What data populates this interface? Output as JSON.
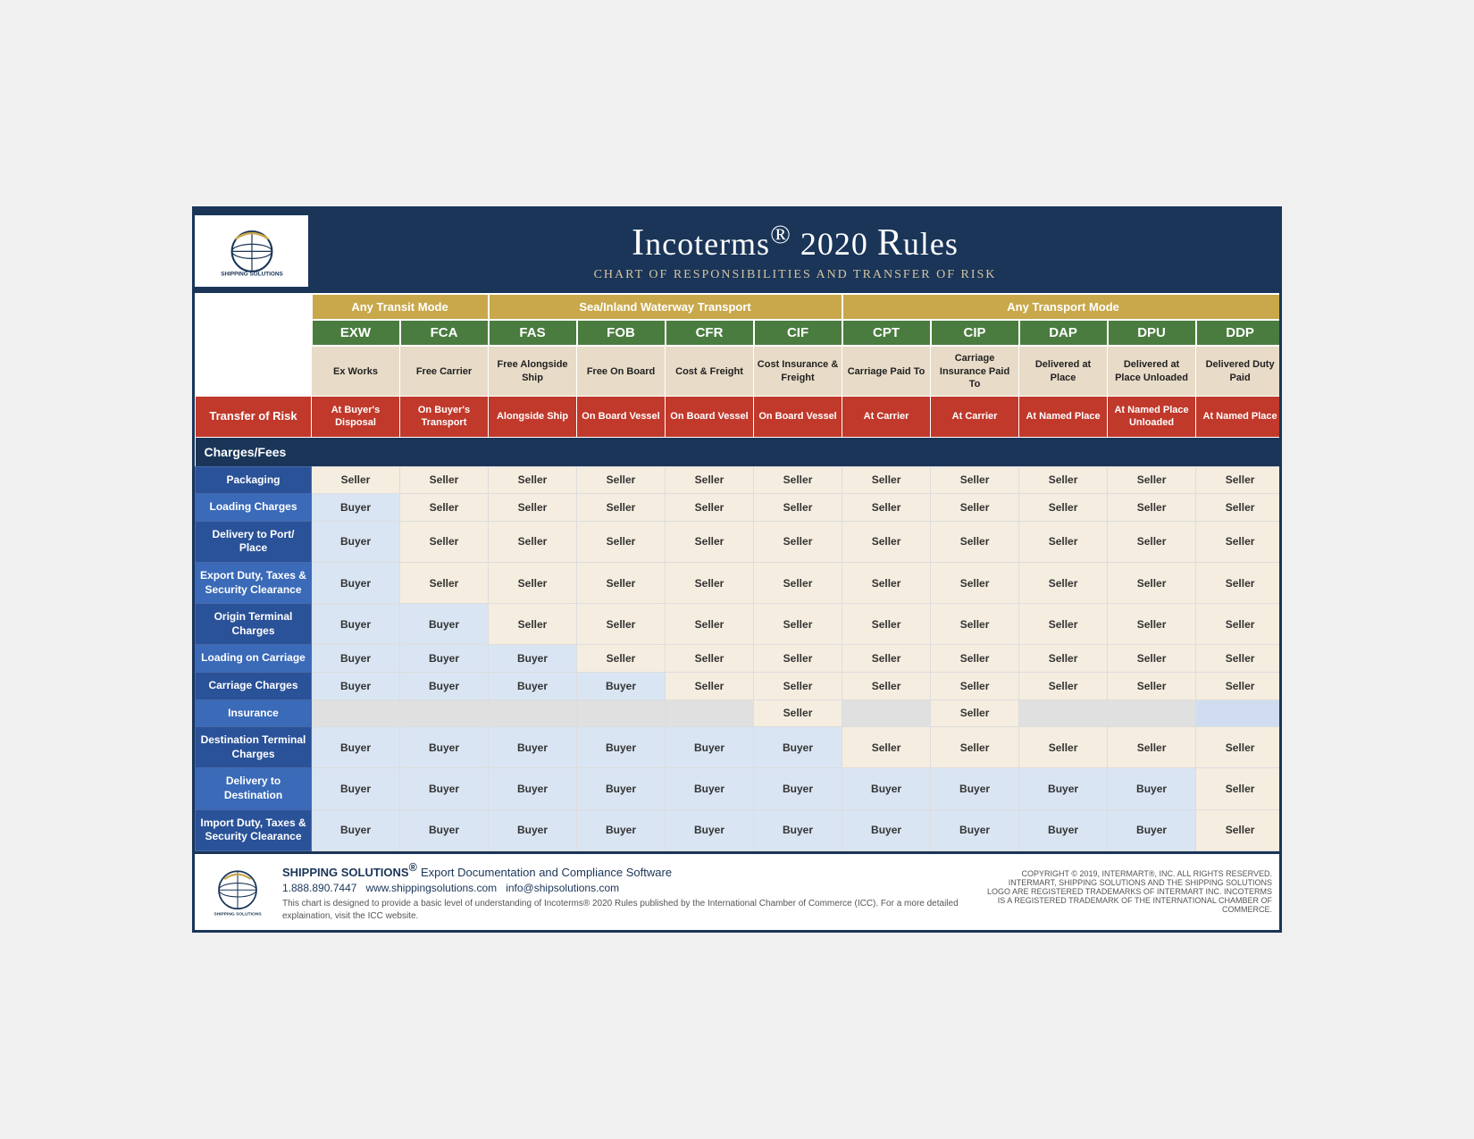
{
  "header": {
    "title_part1": "Incoterms",
    "title_registered": "®",
    "title_part2": " 2020 Rules",
    "subtitle": "Chart of Responsibilities and transfer of risk",
    "company": "Shipping Solutions"
  },
  "groups": [
    {
      "label": "Any Transit Mode",
      "colspan": 2,
      "color": "#c8a84b"
    },
    {
      "label": "Sea/Inland Waterway Transport",
      "colspan": 4,
      "color": "#c8a84b"
    },
    {
      "label": "Any Transport Mode",
      "colspan": 5,
      "color": "#c8a84b"
    }
  ],
  "codes": [
    "EXW",
    "FCA",
    "FAS",
    "FOB",
    "CFR",
    "CIF",
    "CPT",
    "CIP",
    "DAP",
    "DPU",
    "DDP"
  ],
  "descriptions": [
    "Ex Works",
    "Free Carrier",
    "Free Alongside Ship",
    "Free On Board",
    "Cost & Freight",
    "Cost Insurance & Freight",
    "Carriage Paid To",
    "Carriage Insurance Paid To",
    "Delivered at Place",
    "Delivered at Place Unloaded",
    "Delivered Duty Paid"
  ],
  "transfer_of_risk_label": "Transfer of Risk",
  "risk_values": [
    "At Buyer's Disposal",
    "On Buyer's Transport",
    "Alongside Ship",
    "On Board Vessel",
    "On Board Vessel",
    "On Board Vessel",
    "At Carrier",
    "At Carrier",
    "At Named Place",
    "At Named Place Unloaded",
    "At Named Place"
  ],
  "charges_section": "Charges/Fees",
  "rows": [
    {
      "label": "Packaging",
      "values": [
        "Seller",
        "Seller",
        "Seller",
        "Seller",
        "Seller",
        "Seller",
        "Seller",
        "Seller",
        "Seller",
        "Seller",
        "Seller"
      ],
      "types": [
        "seller",
        "seller",
        "seller",
        "seller",
        "seller",
        "seller",
        "seller",
        "seller",
        "seller",
        "seller",
        "seller"
      ]
    },
    {
      "label": "Loading Charges",
      "values": [
        "Buyer",
        "Seller",
        "Seller",
        "Seller",
        "Seller",
        "Seller",
        "Seller",
        "Seller",
        "Seller",
        "Seller",
        "Seller"
      ],
      "types": [
        "buyer",
        "seller",
        "seller",
        "seller",
        "seller",
        "seller",
        "seller",
        "seller",
        "seller",
        "seller",
        "seller"
      ]
    },
    {
      "label": "Delivery to Port/ Place",
      "values": [
        "Buyer",
        "Seller",
        "Seller",
        "Seller",
        "Seller",
        "Seller",
        "Seller",
        "Seller",
        "Seller",
        "Seller",
        "Seller"
      ],
      "types": [
        "buyer",
        "seller",
        "seller",
        "seller",
        "seller",
        "seller",
        "seller",
        "seller",
        "seller",
        "seller",
        "seller"
      ]
    },
    {
      "label": "Export Duty, Taxes & Security Clearance",
      "values": [
        "Buyer",
        "Seller",
        "Seller",
        "Seller",
        "Seller",
        "Seller",
        "Seller",
        "Seller",
        "Seller",
        "Seller",
        "Seller"
      ],
      "types": [
        "buyer",
        "seller",
        "seller",
        "seller",
        "seller",
        "seller",
        "seller",
        "seller",
        "seller",
        "seller",
        "seller"
      ]
    },
    {
      "label": "Origin Terminal Charges",
      "values": [
        "Buyer",
        "Buyer",
        "Seller",
        "Seller",
        "Seller",
        "Seller",
        "Seller",
        "Seller",
        "Seller",
        "Seller",
        "Seller"
      ],
      "types": [
        "buyer",
        "buyer",
        "seller",
        "seller",
        "seller",
        "seller",
        "seller",
        "seller",
        "seller",
        "seller",
        "seller"
      ]
    },
    {
      "label": "Loading on Carriage",
      "values": [
        "Buyer",
        "Buyer",
        "Buyer",
        "Seller",
        "Seller",
        "Seller",
        "Seller",
        "Seller",
        "Seller",
        "Seller",
        "Seller"
      ],
      "types": [
        "buyer",
        "buyer",
        "buyer",
        "seller",
        "seller",
        "seller",
        "seller",
        "seller",
        "seller",
        "seller",
        "seller"
      ]
    },
    {
      "label": "Carriage Charges",
      "values": [
        "Buyer",
        "Buyer",
        "Buyer",
        "Buyer",
        "Seller",
        "Seller",
        "Seller",
        "Seller",
        "Seller",
        "Seller",
        "Seller"
      ],
      "types": [
        "buyer",
        "buyer",
        "buyer",
        "buyer",
        "seller",
        "seller",
        "seller",
        "seller",
        "seller",
        "seller",
        "seller"
      ]
    },
    {
      "label": "Insurance",
      "values": [
        "",
        "",
        "",
        "",
        "",
        "Seller",
        "",
        "Seller",
        "",
        "",
        ""
      ],
      "types": [
        "empty",
        "empty",
        "empty",
        "empty",
        "empty",
        "seller",
        "empty",
        "seller",
        "empty",
        "empty",
        "seller-blue"
      ]
    },
    {
      "label": "Destination Terminal Charges",
      "values": [
        "Buyer",
        "Buyer",
        "Buyer",
        "Buyer",
        "Buyer",
        "Buyer",
        "Seller",
        "Seller",
        "Seller",
        "Seller",
        "Seller"
      ],
      "types": [
        "buyer",
        "buyer",
        "buyer",
        "buyer",
        "buyer",
        "buyer",
        "seller",
        "seller",
        "seller",
        "seller",
        "seller"
      ]
    },
    {
      "label": "Delivery to Destination",
      "values": [
        "Buyer",
        "Buyer",
        "Buyer",
        "Buyer",
        "Buyer",
        "Buyer",
        "Buyer",
        "Buyer",
        "Buyer",
        "Buyer",
        "Seller"
      ],
      "types": [
        "buyer",
        "buyer",
        "buyer",
        "buyer",
        "buyer",
        "buyer",
        "buyer",
        "buyer",
        "buyer",
        "buyer",
        "seller"
      ]
    },
    {
      "label": "Import Duty, Taxes & Security Clearance",
      "values": [
        "Buyer",
        "Buyer",
        "Buyer",
        "Buyer",
        "Buyer",
        "Buyer",
        "Buyer",
        "Buyer",
        "Buyer",
        "Buyer",
        "Seller"
      ],
      "types": [
        "buyer",
        "buyer",
        "buyer",
        "buyer",
        "buyer",
        "buyer",
        "buyer",
        "buyer",
        "buyer",
        "buyer",
        "seller"
      ]
    }
  ],
  "footer": {
    "company_name": "SHIPPING SOLUTIONS",
    "registered": "®",
    "tagline": "Export Documentation and Compliance Software",
    "phone": "1.888.890.7447",
    "website": "www.shippingsolutions.com",
    "email": "info@shipsolutions.com",
    "note": "This chart is designed to provide a basic level of understanding of Incoterms® 2020 Rules published by the International Chamber of Commerce (ICC). For a more detailed explaination, visit the ICC website.",
    "copyright": "COPYRIGHT © 2019, INTERMART®, INC. ALL RIGHTS RESERVED. INTERMART, SHIPPING SOLUTIONS AND THE SHIPPING SOLUTIONS LOGO ARE REGISTERED TRADEMARKS OF INTERMART INC. INCOTERMS IS A REGISTERED TRADEMARK OF THE INTERNATIONAL CHAMBER OF COMMERCE."
  }
}
